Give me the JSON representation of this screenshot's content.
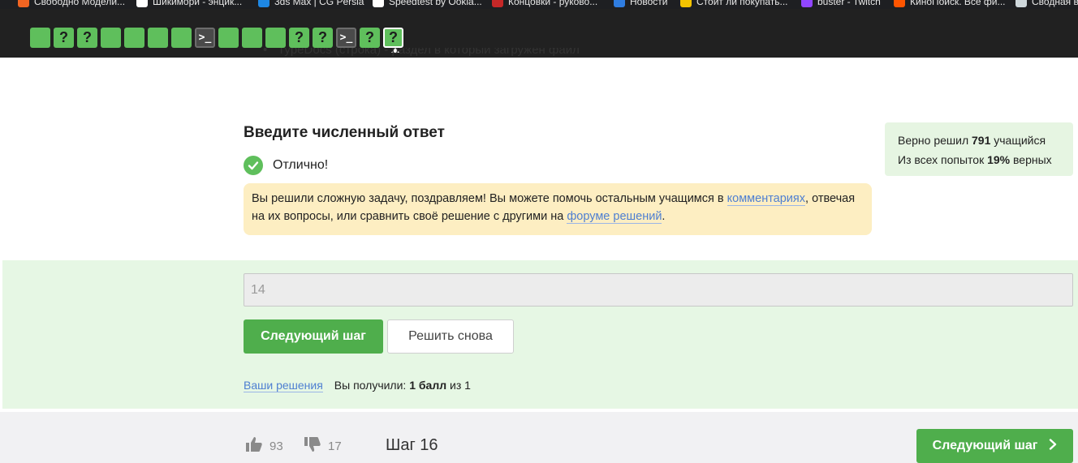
{
  "bookmarks": [
    {
      "label": "Свободно Модели...",
      "color": "#f26522"
    },
    {
      "label": "Шикимори - энцик...",
      "color": "#ffffff"
    },
    {
      "label": "3ds Max | CG Persia",
      "color": "#1e88e5"
    },
    {
      "label": "Speedtest by Ookla...",
      "color": "#ffffff"
    },
    {
      "label": "Концовки - руково...",
      "color": "#c62828"
    },
    {
      "label": "Новости",
      "color": "#2f7de1"
    },
    {
      "label": "Стоит ли покупать...",
      "color": "#f5c400"
    },
    {
      "label": "buster - Twitch",
      "color": "#9146ff"
    },
    {
      "label": "КиноПоиск. Все фи...",
      "color": "#ff5500"
    },
    {
      "label": "Сводная в...",
      "color": "#cfd8dc"
    }
  ],
  "steps": [
    {
      "kind": "done",
      "glyph": ""
    },
    {
      "kind": "question",
      "glyph": "?"
    },
    {
      "kind": "question",
      "glyph": "?"
    },
    {
      "kind": "done",
      "glyph": ""
    },
    {
      "kind": "done",
      "glyph": ""
    },
    {
      "kind": "done",
      "glyph": ""
    },
    {
      "kind": "done",
      "glyph": ""
    },
    {
      "kind": "code",
      "glyph": ">_"
    },
    {
      "kind": "done",
      "glyph": ""
    },
    {
      "kind": "done",
      "glyph": ""
    },
    {
      "kind": "done",
      "glyph": ""
    },
    {
      "kind": "question",
      "glyph": "?"
    },
    {
      "kind": "question",
      "glyph": "?"
    },
    {
      "kind": "code",
      "glyph": ">_"
    },
    {
      "kind": "question",
      "glyph": "?"
    },
    {
      "kind": "current",
      "glyph": "?"
    }
  ],
  "lesson": {
    "cut_list_item": "TypeDocs (строка) - раздел в который загружен файл"
  },
  "task": {
    "heading": "Введите численный ответ",
    "status": "Отлично!",
    "congrats": {
      "text_1": "Вы решили сложную задачу, поздравляем! Вы можете помочь остальным учащимся в ",
      "link_comments": "комментариях",
      "text_2": ", отвечая на их вопросы, или сравнить своё решение с другими на ",
      "link_forum": "форуме решений",
      "text_3": "."
    },
    "answer_value": "14",
    "next_button": "Следующий шаг",
    "retry_button": "Решить снова",
    "my_solutions_link": "Ваши решения",
    "score_prefix": "Вы получили:",
    "score_bold": "1 балл",
    "score_suffix": "из 1"
  },
  "stats": {
    "line1_prefix": "Верно решил",
    "solved_count": "791",
    "line1_suffix": "учащийся",
    "line2_prefix": "Из всех попыток",
    "percent": "19%",
    "line2_suffix": "верных"
  },
  "footer": {
    "likes": "93",
    "dislikes": "17",
    "step_label": "Шаг 16",
    "next_button": "Следующий шаг"
  },
  "colors": {
    "accent_green": "#4fae4c",
    "step_green": "#5fbf5c",
    "link_blue": "#4e7fd1",
    "congrats_bg": "#fdeec2",
    "answer_zone_bg": "#e6f7e4"
  },
  "icons": {
    "status": "check-circle-icon",
    "like": "thumbs-up-icon",
    "dislike": "thumbs-down-icon",
    "next_arrow": "chevron-right-icon"
  }
}
